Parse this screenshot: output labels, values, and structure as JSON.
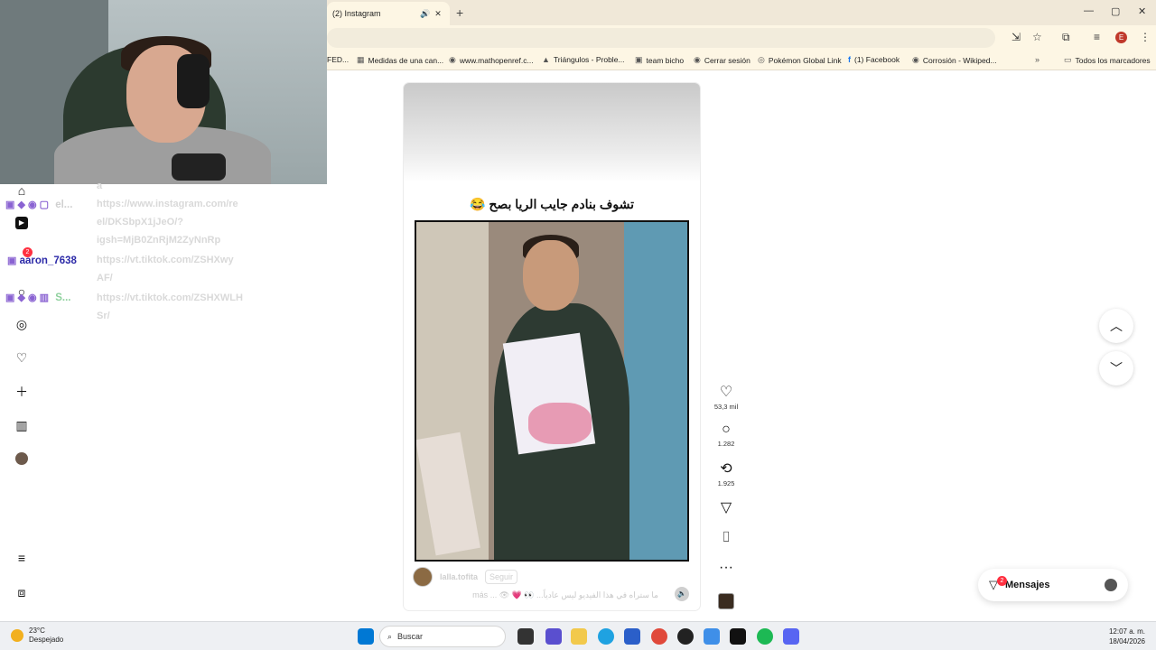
{
  "browser": {
    "tab_title": "(2) Instagram",
    "tab_icons": {
      "audio": "🔊",
      "close": "✕"
    },
    "new_tab": "+",
    "window_controls": {
      "min": "—",
      "max": "▢",
      "close": "✕"
    },
    "toolbar_icons": {
      "install": "⇲",
      "star": "☆",
      "extensions": "⧉",
      "media": "≡",
      "profile": "E",
      "menu": "⋮"
    }
  },
  "bookmarks": [
    {
      "label": "FED..."
    },
    {
      "icon": "▦",
      "label": "Medidas de una can..."
    },
    {
      "icon": "◉",
      "label": "www.mathopenref.c..."
    },
    {
      "icon": "▲",
      "label": "Triángulos - Proble..."
    },
    {
      "icon": "▣",
      "label": "team bicho"
    },
    {
      "icon": "◉",
      "label": "Cerrar sesión"
    },
    {
      "icon": "◎",
      "label": "Pokémon Global Link"
    },
    {
      "icon": "f",
      "label": "(1) Facebook"
    },
    {
      "icon": "◉",
      "label": "Corrosión - Wikiped..."
    },
    {
      "icon": "»",
      "label": ""
    },
    {
      "icon": "▭",
      "label": "Todos los marcadores"
    }
  ],
  "chat": {
    "line1_name": "el...",
    "line1_msg": [
      "a",
      "https://www.instagram.com/re",
      "el/DKSbpX1jJeO/?",
      "igsh=MjB0ZnRjM2ZyNnRp"
    ],
    "line2_name": "aaron_7638",
    "line2_msg": [
      "https://vt.tiktok.com/ZSHXwy",
      "AF/"
    ],
    "line3_name": "S...",
    "line3_msg": [
      "https://vt.tiktok.com/ZSHXWLH",
      "Sr/"
    ],
    "badge_count": "2"
  },
  "reel": {
    "caption": "تشوف بنادم جايب الريا بصح 😂",
    "username": "lalla.tofita",
    "follow": "Seguir",
    "description": "ما ستراه في هذا الفيديو ليس عادياً... 👀 💗 👁 ... más",
    "mute_icon": "🔈"
  },
  "actions": {
    "likes": "53,3 mil",
    "comments": "1.282",
    "shares": "1.925"
  },
  "messages": {
    "label": "Mensajes",
    "badge": "2"
  },
  "taskbar": {
    "temp": "23°C",
    "condition": "Despejado",
    "search": "Buscar",
    "time": "12:07 a. m.",
    "date": "18/04/2026"
  },
  "colors": {
    "chat_name": "#2c2aa8",
    "badge": "#ff3040",
    "tab_bg": "#f0e8d8"
  }
}
